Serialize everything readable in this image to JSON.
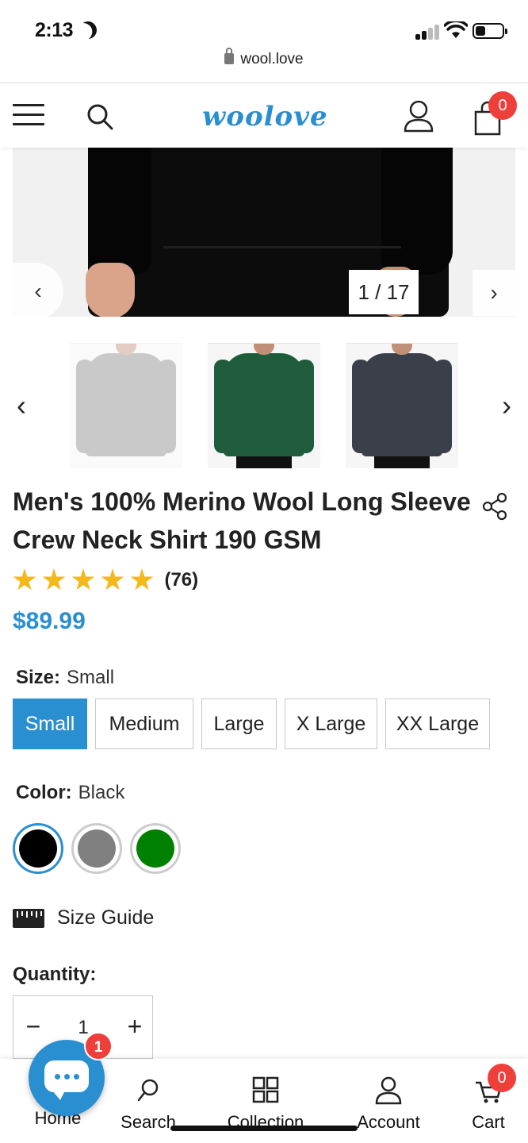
{
  "status_bar": {
    "time": "2:13",
    "url": "wool.love"
  },
  "header": {
    "logo": "woolove",
    "cart_count": "0"
  },
  "gallery": {
    "counter": "1 / 17",
    "prev_icon": "chevron-left-icon",
    "next_icon": "chevron-right-icon"
  },
  "thumbnails": [
    {
      "color": "#8a8a8a",
      "label": "grey shirt"
    },
    {
      "color": "#1f5c3c",
      "label": "green shirt"
    },
    {
      "color": "#3a3f4a",
      "label": "charcoal shirt"
    }
  ],
  "product": {
    "title": "Men's 100% Merino Wool Long Sleeve Crew Neck Shirt 190 GSM",
    "rating": 5,
    "review_count": "(76)",
    "price": "$89.99"
  },
  "size": {
    "label": "Size:",
    "selected": "Small",
    "options": [
      "Small",
      "Medium",
      "Large",
      "X Large",
      "XX Large"
    ]
  },
  "color": {
    "label": "Color:",
    "selected": "Black",
    "swatches": [
      "#000000",
      "#808080",
      "#008000"
    ]
  },
  "size_guide": "Size Guide",
  "quantity": {
    "label": "Quantity:",
    "value": "1",
    "minus": "−",
    "plus": "+"
  },
  "bottom_nav": {
    "items": [
      "Home",
      "Search",
      "Collection",
      "Account",
      "Cart"
    ],
    "cart_count": "0",
    "chat_badge": "1"
  },
  "colors": {
    "accent": "#2a8fd0",
    "badge": "#ef3f3a",
    "star": "#f5b81b"
  }
}
